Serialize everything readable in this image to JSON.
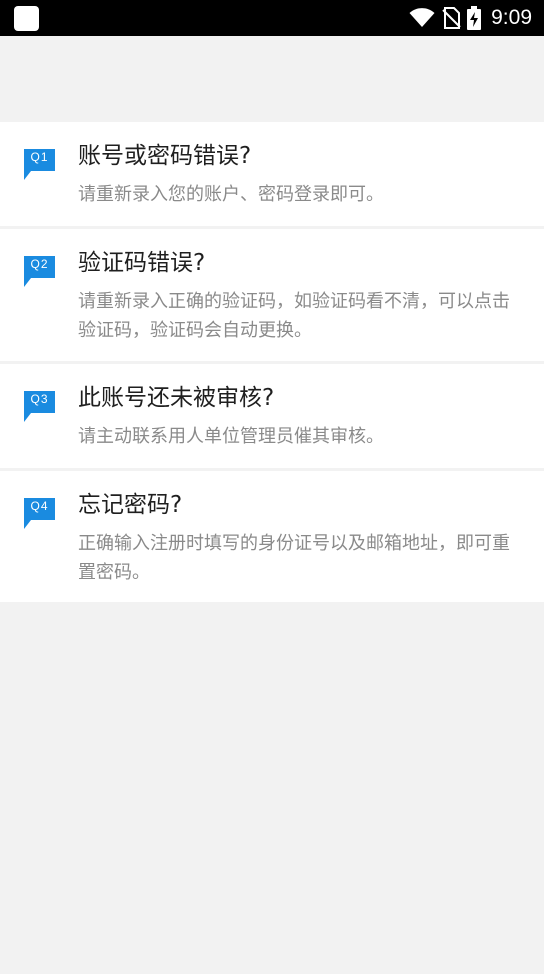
{
  "status_bar": {
    "time": "9:09",
    "icons": [
      "app-notification-icon",
      "wifi-icon",
      "no-sim-icon",
      "battery-charging-icon"
    ]
  },
  "faq": {
    "accent_color": "#1a8be0",
    "items": [
      {
        "badge": "Q1",
        "question": "账号或密码错误?",
        "answer": "请重新录入您的账户、密码登录即可。"
      },
      {
        "badge": "Q2",
        "question": "验证码错误?",
        "answer": "请重新录入正确的验证码，如验证码看不清，可以点击验证码，验证码会自动更换。"
      },
      {
        "badge": "Q3",
        "question": "此账号还未被审核?",
        "answer": "请主动联系用人单位管理员催其审核。"
      },
      {
        "badge": "Q4",
        "question": "忘记密码?",
        "answer": "正确输入注册时填写的身份证号以及邮箱地址，即可重置密码。"
      }
    ]
  }
}
